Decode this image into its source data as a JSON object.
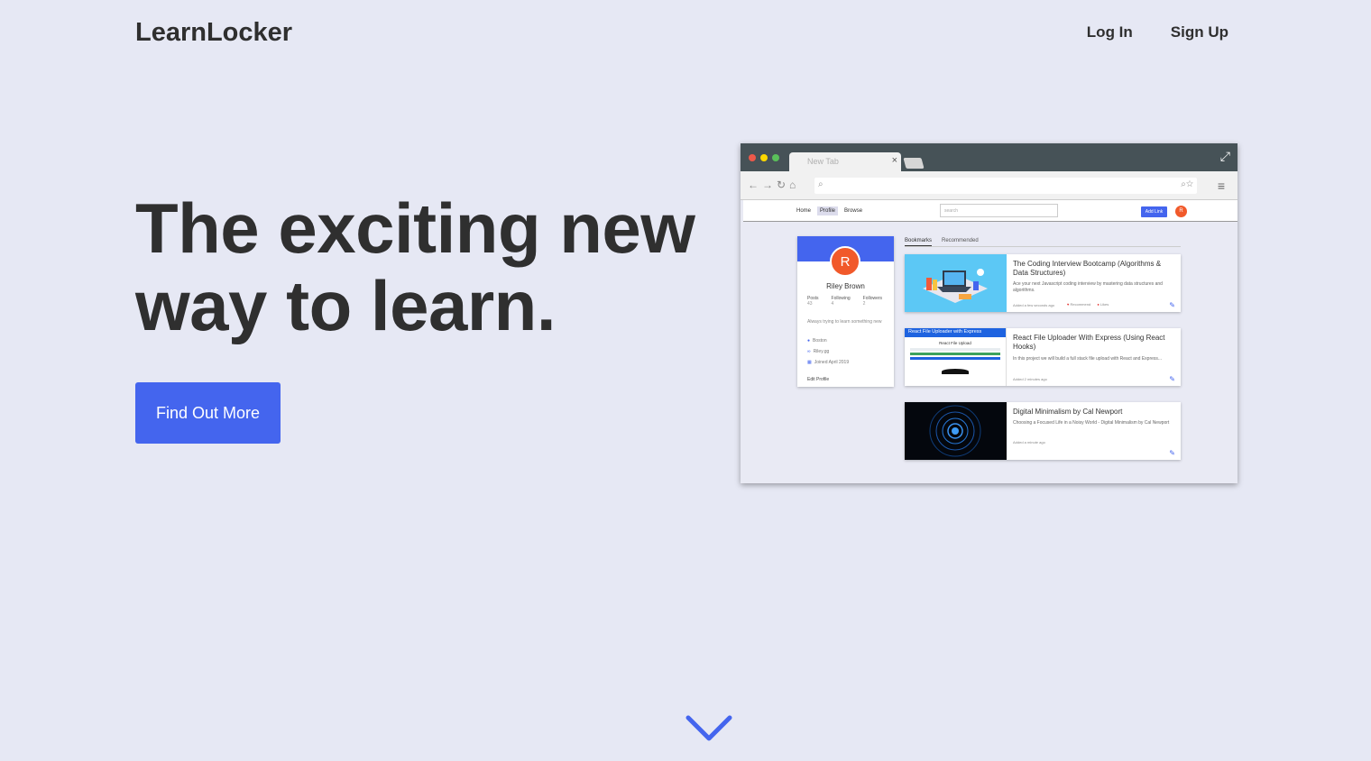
{
  "header": {
    "logo": "LearnLocker",
    "nav": [
      "Log In",
      "Sign Up"
    ]
  },
  "hero": {
    "title": "The exciting new way to learn.",
    "cta": "Find Out More"
  },
  "mockup": {
    "tab_title": "New Tab",
    "app_nav": [
      "Home",
      "Profile",
      "Browse"
    ],
    "search_placeholder": "search",
    "add_link": "Add Link",
    "avatar_initial": "R",
    "profile": {
      "initial": "R",
      "name": "Riley Brown",
      "stats": [
        {
          "label": "Posts",
          "value": "43"
        },
        {
          "label": "Following",
          "value": "4"
        },
        {
          "label": "Followers",
          "value": "2"
        }
      ],
      "bio": "Always trying to learn something new",
      "location": "Boston",
      "link": "Riley.gg",
      "joined": "Joined April 2019",
      "edit": "Edit Profile"
    },
    "tabs": [
      "Bookmarks",
      "Recommended"
    ],
    "cards": [
      {
        "title": "The Coding Interview Bootcamp (Algorithms & Data Structures)",
        "desc": "Ace your next Javascript coding interview by mastering data structures and algorithms.",
        "time": "Added a few seconds ago",
        "recommend": "Recommend",
        "likes": "Likes"
      },
      {
        "title": "React File Uploader With Express (Using React Hooks)",
        "desc": "In this project we will build a full stack file upload with React and Express...",
        "time": "Added 2 minutes ago",
        "banner": "React File Uploader with Express",
        "inner_title": "React File Upload"
      },
      {
        "title": "Digital Minimalism by Cal Newport",
        "desc": "Choosing a Focused Life in a Noisy World - Digital Minimalism by Cal Newport",
        "time": "Added a minute ago"
      }
    ]
  },
  "colors": {
    "background": "#e6e8f4",
    "accent": "#4465ee",
    "avatar": "#f1592a",
    "browser_chrome": "#465257"
  },
  "icons": [
    "chevron-down-icon",
    "expand-icon",
    "search-icon",
    "star-icon",
    "menu-icon",
    "back-icon",
    "forward-icon",
    "reload-icon",
    "home-icon",
    "location-icon",
    "link-icon",
    "calendar-icon",
    "edit-icon"
  ]
}
